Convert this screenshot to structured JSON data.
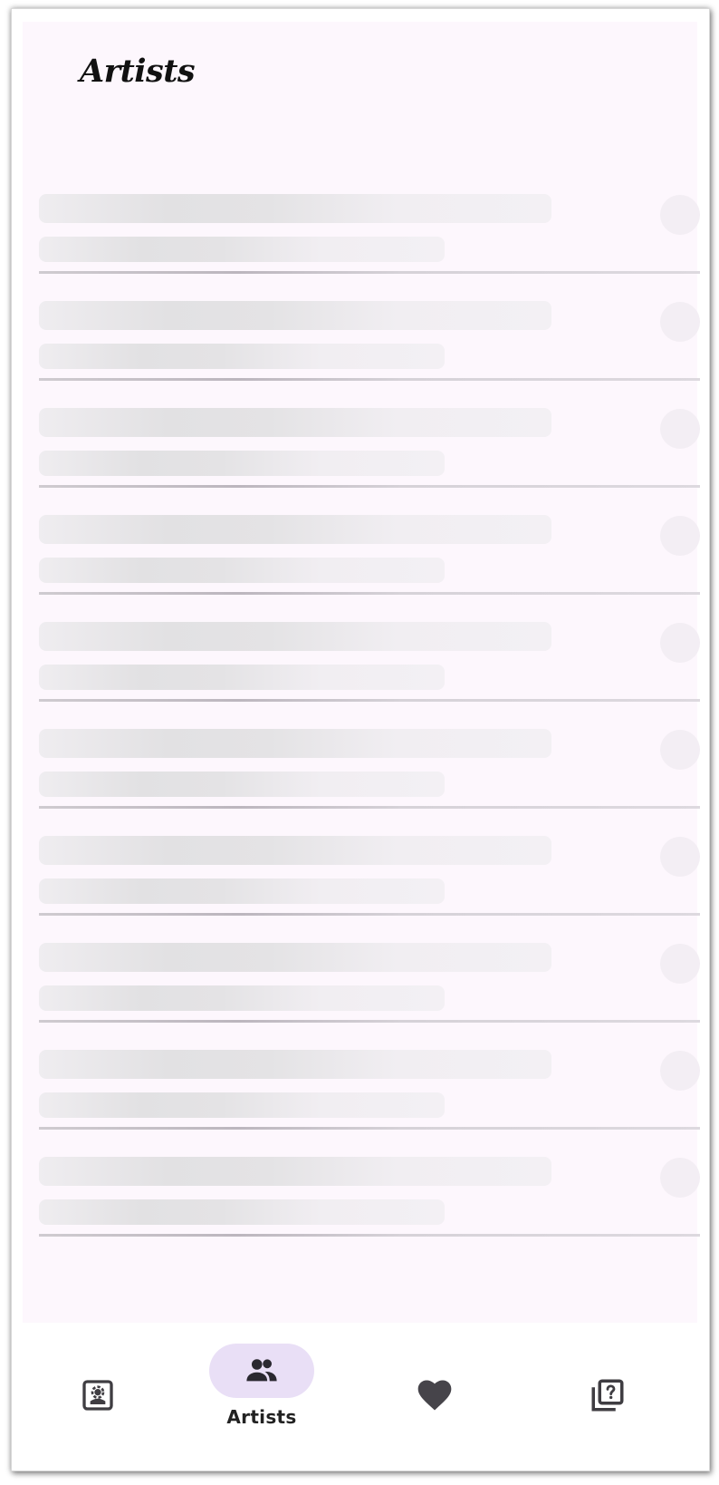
{
  "header": {
    "title": "Artists"
  },
  "list": {
    "placeholder_rows": 10,
    "state": "loading"
  },
  "bottom_nav": {
    "items": [
      {
        "icon": "photo-album-icon",
        "label": "",
        "active": false
      },
      {
        "icon": "artists-icon",
        "label": "Artists",
        "active": true
      },
      {
        "icon": "heart-icon",
        "label": "",
        "active": false
      },
      {
        "icon": "quiz-library-icon",
        "label": "",
        "active": false
      }
    ],
    "active_color": "#e9dff6"
  },
  "colors": {
    "background": "#fdf7fd",
    "skeleton": "#e2e1e3",
    "icon": "#3f3d42"
  }
}
